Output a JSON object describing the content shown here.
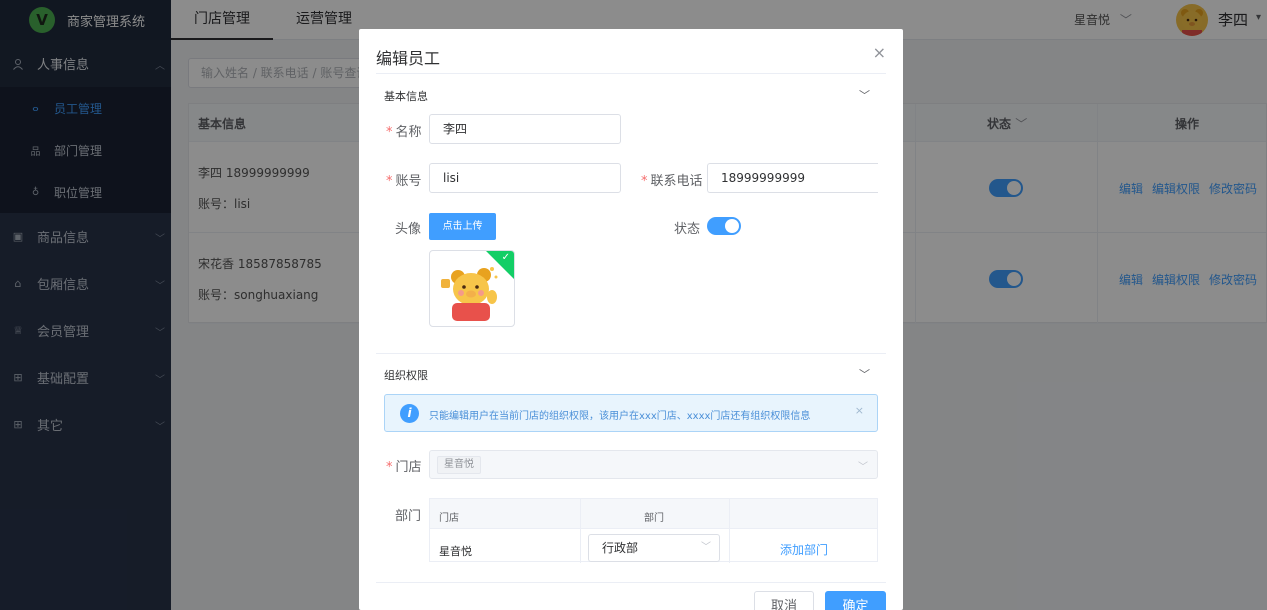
{
  "app": {
    "logo_letter": "V",
    "title": "商家管理系统"
  },
  "sidebar": {
    "items": [
      {
        "label": "人事信息",
        "icon": "user-icon",
        "open": true,
        "children": [
          {
            "label": "员工管理",
            "icon": "users-icon",
            "active": true
          },
          {
            "label": "部门管理",
            "icon": "org-icon"
          },
          {
            "label": "职位管理",
            "icon": "badge-icon"
          }
        ]
      },
      {
        "label": "商品信息",
        "icon": "goods-icon"
      },
      {
        "label": "包厢信息",
        "icon": "room-icon"
      },
      {
        "label": "会员管理",
        "icon": "member-icon"
      },
      {
        "label": "基础配置",
        "icon": "grid-icon"
      },
      {
        "label": "其它",
        "icon": "grid-icon"
      }
    ]
  },
  "topbar": {
    "tabs": [
      "门店管理",
      "运营管理"
    ],
    "active_tab": 0,
    "store": "星音悦",
    "user_name": "李四"
  },
  "list": {
    "search_placeholder": "输入姓名 / 联系电话 / 账号查询",
    "headers": {
      "basic": "基本信息",
      "status": "状态",
      "ops": "操作"
    },
    "rows": [
      {
        "name_phone": "李四    18999999999",
        "account": "账号：lisi",
        "enabled": true
      },
      {
        "name_phone": "宋花香    18587858785",
        "account": "账号：songhuaxiang",
        "enabled": true
      }
    ],
    "ops": [
      "编辑",
      "编辑权限",
      "修改密码"
    ]
  },
  "dialog": {
    "title": "编辑员工",
    "section_basic": "基本信息",
    "name_label": "名称",
    "name_value": "李四",
    "account_label": "账号",
    "account_value": "lisi",
    "phone_label": "联系电话",
    "phone_value": "18999999999",
    "avatar_label": "头像",
    "upload_button": "点击上传",
    "status_label": "状态",
    "status_on": true,
    "section_org": "组织权限",
    "alert_text": "只能编辑用户在当前门店的组织权限，该用户在xxx门店、xxxx门店还有组织权限信息",
    "store_label": "门店",
    "store_tag": "星音悦",
    "dept_label": "部门",
    "dept_table": {
      "headers": [
        "门店",
        "部门"
      ],
      "rows": [
        {
          "store": "星音悦",
          "dept": "行政部",
          "action": "添加部门"
        }
      ]
    },
    "cancel": "取消",
    "confirm": "确定"
  }
}
